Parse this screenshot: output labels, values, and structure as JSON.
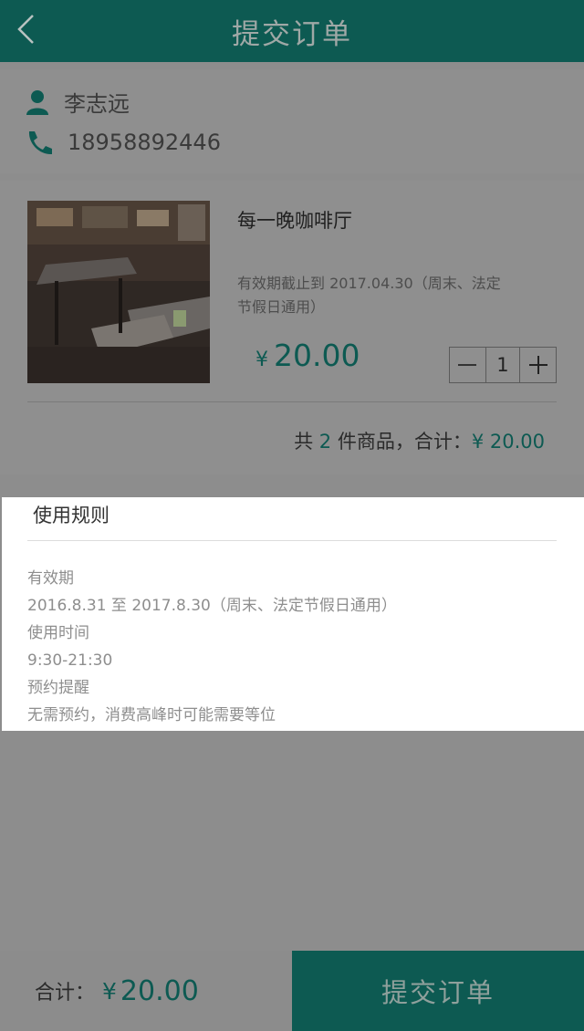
{
  "header": {
    "title": "提交订单",
    "back_icon": "chevron-left-icon"
  },
  "contact": {
    "name": "李志远",
    "phone": "18958892446",
    "user_icon": "user-icon",
    "phone_icon": "phone-icon"
  },
  "order": {
    "store_name": "每一晚咖啡厅",
    "validity": "有效期截止到 2017.04.30（周末、法定节假日通用）",
    "price_symbol": "¥",
    "price": "20.00",
    "quantity": "1",
    "summary": {
      "prefix": "共",
      "count": "2",
      "middle": "件商品，合计：",
      "total": "¥ 20.00"
    }
  },
  "rules": {
    "title": "使用规则",
    "items": [
      "有效期",
      "2016.8.31 至 2017.8.30（周末、法定节假日通用）",
      "使用时间",
      "9:30-21:30",
      "预约提醒",
      "无需预约，消费高峰时可能需要等位"
    ]
  },
  "footer": {
    "total_label": "合计：",
    "total_symbol": "¥",
    "total_value": "20.00",
    "submit_label": "提交订单"
  },
  "colors": {
    "brand": "#0d5a52",
    "overlay_bg": "#8d8d8d",
    "card_bg": "#ffffff"
  }
}
